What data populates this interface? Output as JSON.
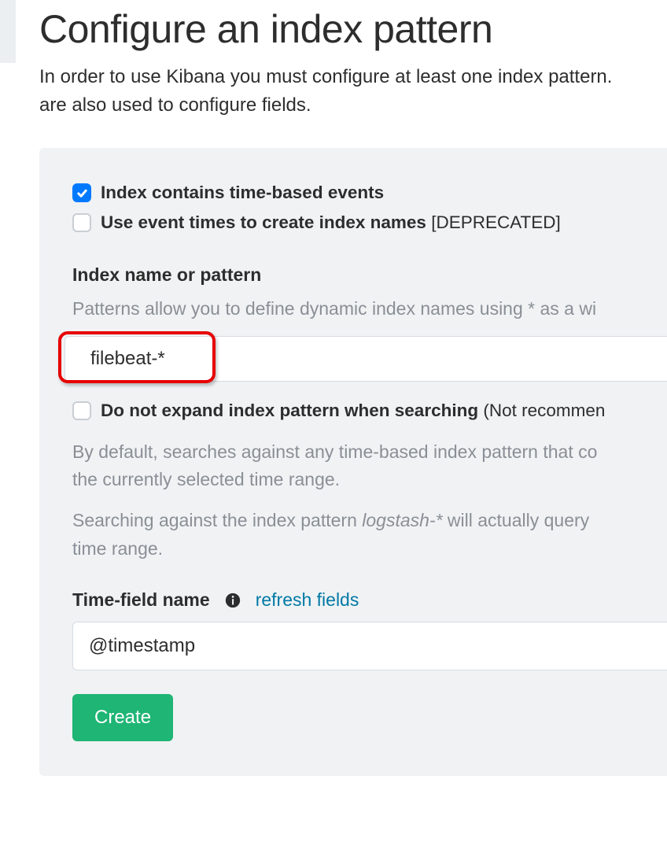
{
  "title": "Configure an index pattern",
  "subtitle_line1": "In order to use Kibana you must configure at least one index pattern.",
  "subtitle_line2": "are also used to configure fields.",
  "checkboxes": {
    "timebased": {
      "label": "Index contains time-based events",
      "checked": true
    },
    "eventtimes": {
      "label": "Use event times to create index names",
      "extra": " [DEPRECATED]",
      "checked": false
    },
    "noexpand": {
      "label": "Do not expand index pattern when searching",
      "extra": " (Not recommen",
      "checked": false
    }
  },
  "indexPattern": {
    "label": "Index name or pattern",
    "help": "Patterns allow you to define dynamic index names using * as a wi",
    "value": "filebeat-*"
  },
  "expandHelp": {
    "p1": "By default, searches against any time-based index pattern that co",
    "p2": "the currently selected time range.",
    "p3a": "Searching against the index pattern ",
    "p3i": "logstash-*",
    "p3b": " will actually query ",
    "p4": "time range."
  },
  "timefield": {
    "label": "Time-field name",
    "refresh": "refresh fields",
    "value": "@timestamp"
  },
  "createLabel": "Create"
}
